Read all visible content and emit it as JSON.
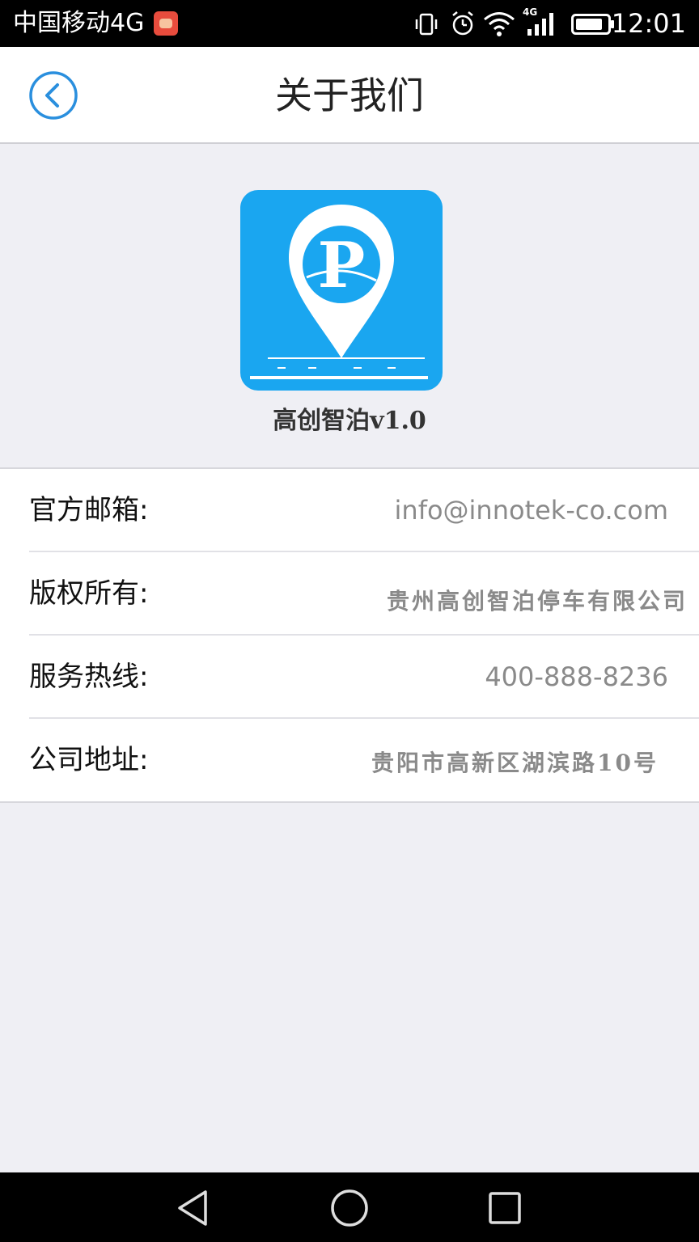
{
  "status_bar": {
    "carrier": "中国移动4G",
    "time": "12:01",
    "network_badge": "4G",
    "icons": [
      "app-notification-icon",
      "vibrate-icon",
      "alarm-icon",
      "wifi-icon",
      "signal-icon",
      "battery-icon"
    ]
  },
  "nav": {
    "title": "关于我们",
    "back_icon": "chevron-left-circle-icon",
    "accent_color": "#2a8fde"
  },
  "app": {
    "version_label": "高创智泊v1.0",
    "logo_icon": "parking-pin-logo",
    "logo_letter": "P",
    "logo_color": "#1aa6f0"
  },
  "info": {
    "rows": [
      {
        "label": "官方邮箱:",
        "value": "info@innotek-co.com"
      },
      {
        "label": "版权所有:",
        "value": "贵州高创智泊停车有限公司"
      },
      {
        "label": "服务热线:",
        "value": "400-888-8236"
      },
      {
        "label": "公司地址:",
        "value": "贵阳市高新区湖滨路10号"
      }
    ]
  },
  "system_nav": {
    "buttons": [
      "back-triangle-icon",
      "home-circle-icon",
      "recent-square-icon"
    ]
  }
}
